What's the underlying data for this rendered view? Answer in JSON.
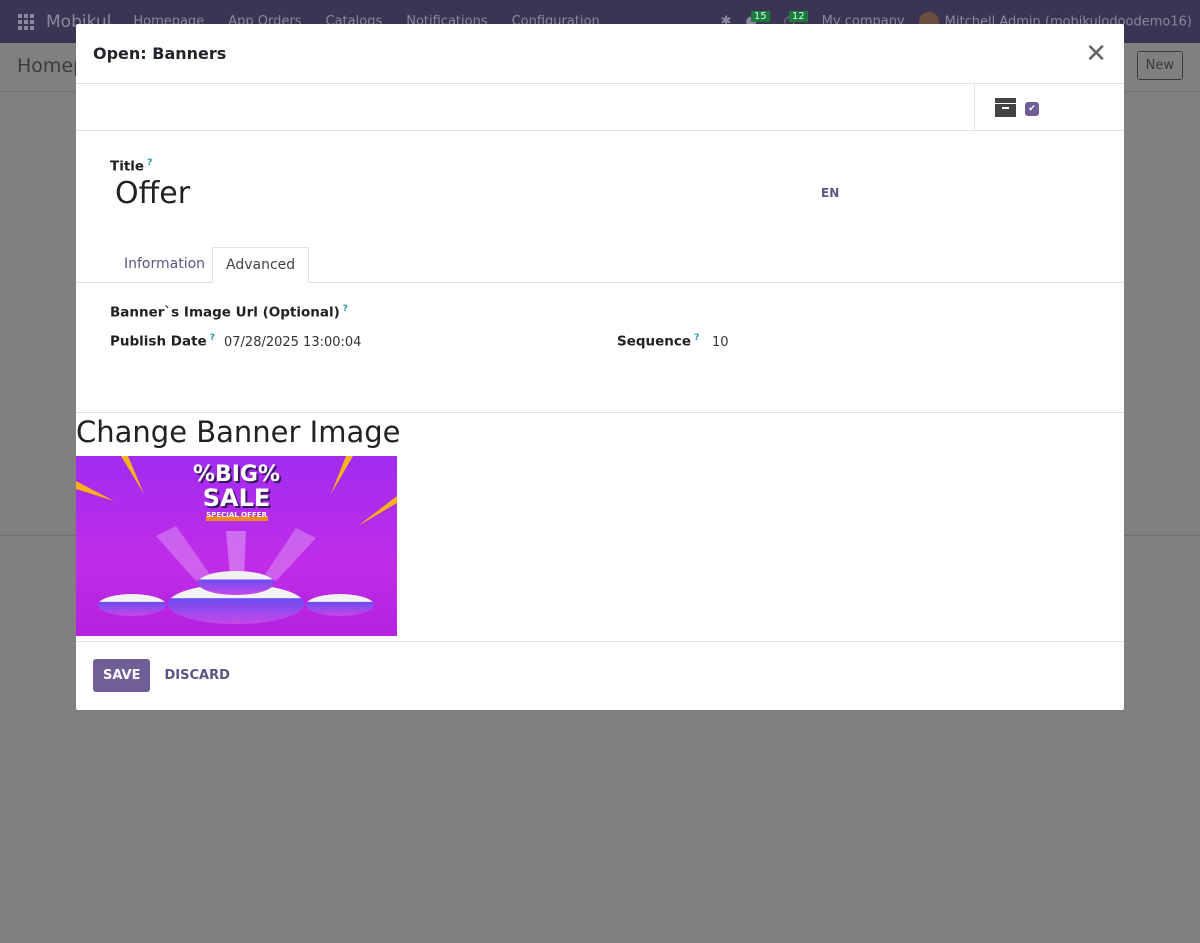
{
  "navbar": {
    "brand": "Mobikul",
    "menu": [
      "Homepage",
      "App Orders",
      "Catalogs",
      "Notifications",
      "Configuration"
    ],
    "messages_count": "15",
    "activities_count": "12",
    "company": "My company",
    "user": "Mitchell Admin (mobikulodoodemo16)"
  },
  "control_panel": {
    "title": "Homep",
    "new_label": "New"
  },
  "dialog": {
    "title": "Open: Banners",
    "fields": {
      "title_label": "Title",
      "help": "?",
      "title_value": "Offer",
      "lang": "EN"
    },
    "tabs": [
      {
        "label": "Information",
        "active": false
      },
      {
        "label": "Advanced",
        "active": true
      }
    ],
    "advanced": {
      "image_url_label": "Banner`s Image Url (Optional)",
      "publish_date_label": "Publish Date",
      "publish_date_value": "07/28/2025 13:00:04",
      "sequence_label": "Sequence",
      "sequence_value": "10"
    },
    "image_section": {
      "heading": "Change Banner Image",
      "banner_text": {
        "line1": "%BIG%",
        "line2": "SALE",
        "line3": "SPECIAL OFFER"
      }
    },
    "footer": {
      "save_label": "SAVE",
      "discard_label": "DISCARD"
    }
  }
}
